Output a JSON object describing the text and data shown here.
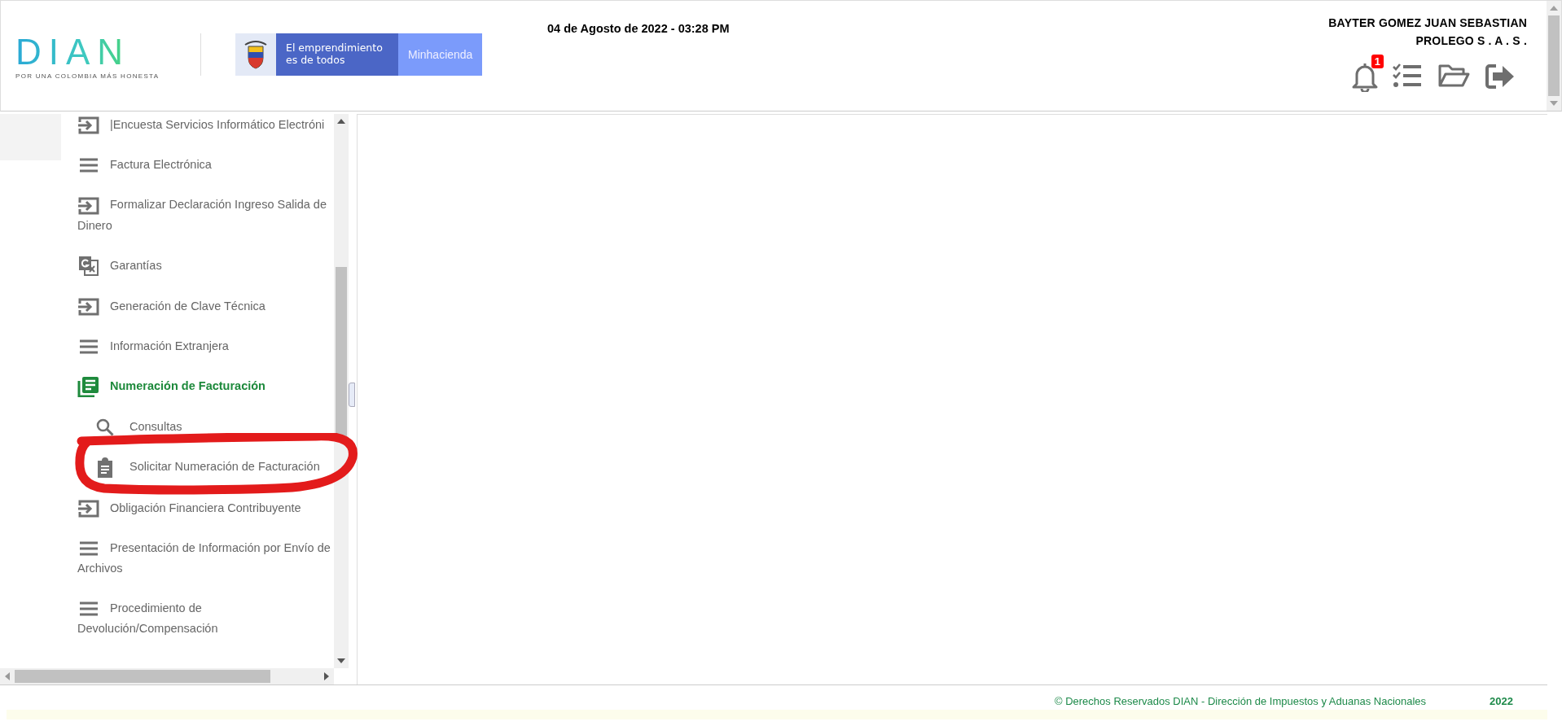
{
  "header": {
    "logo": "DIAN",
    "tagline": "POR UNA COLOMBIA MÁS HONESTA",
    "banner": {
      "slogan": "El emprendimiento es de todos",
      "ministry": "Minhacienda"
    },
    "datetime": "04 de Agosto de 2022 - 03:28 PM",
    "user_name": "BAYTER GOMEZ JUAN SEBASTIAN",
    "company": "PROLEGO S . A . S .",
    "notification_count": "1"
  },
  "sidebar": {
    "items": [
      {
        "label": "|Encuesta Servicios Informático Electróni",
        "kind": "enter",
        "selected": false
      },
      {
        "label": "Factura Electrónica",
        "kind": "menu",
        "selected": false
      },
      {
        "label": "Formalizar Declaración Ingreso Salida de Dinero",
        "kind": "enter",
        "selected": false
      },
      {
        "label": "Garantías",
        "kind": "translate",
        "selected": false
      },
      {
        "label": "Generación de Clave Técnica",
        "kind": "enter",
        "selected": false
      },
      {
        "label": "Información Extranjera",
        "kind": "menu",
        "selected": false
      },
      {
        "label": "Numeración de Facturación",
        "kind": "document",
        "selected": true,
        "expanded": true,
        "children": [
          {
            "label": "Consultas",
            "kind": "search",
            "selected": false
          },
          {
            "label": "Solicitar Numeración de Facturación",
            "kind": "clipboard",
            "selected": false
          }
        ]
      },
      {
        "label": "Obligación Financiera Contribuyente",
        "kind": "enter",
        "selected": false
      },
      {
        "label": "Presentación de Información por Envío de Archivos",
        "kind": "menu",
        "selected": false
      },
      {
        "label": "Procedimiento de Devolución/Compensación",
        "kind": "menu",
        "selected": false
      }
    ]
  },
  "footer": {
    "copyright": "© Derechos Reservados DIAN - Dirección de Impuestos y Aduanas Nacionales",
    "year": "2022"
  }
}
